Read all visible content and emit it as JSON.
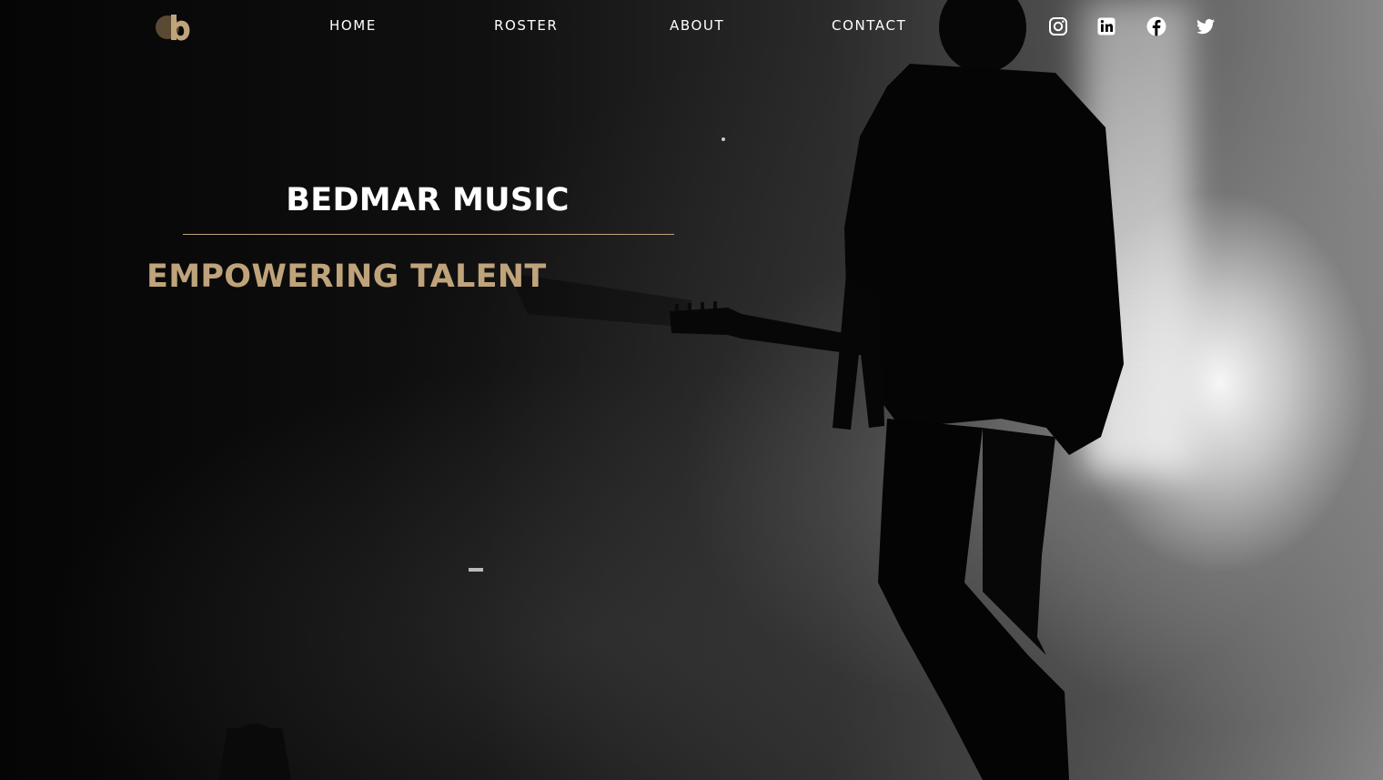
{
  "brand": {
    "logo_icon": "bedmar-b-logo-icon",
    "accent_color": "#bfa37a"
  },
  "nav": {
    "items": [
      {
        "label": "HOME"
      },
      {
        "label": "ROSTER"
      },
      {
        "label": "ABOUT"
      },
      {
        "label": "CONTACT"
      }
    ],
    "social": [
      {
        "icon": "instagram-icon"
      },
      {
        "icon": "linkedin-icon"
      },
      {
        "icon": "facebook-icon"
      },
      {
        "icon": "twitter-icon"
      }
    ]
  },
  "hero": {
    "title": "BEDMAR MUSIC",
    "tagline": "EMPOWERING TALENT",
    "background_image": "guitarist-silhouette-stage-photo"
  }
}
